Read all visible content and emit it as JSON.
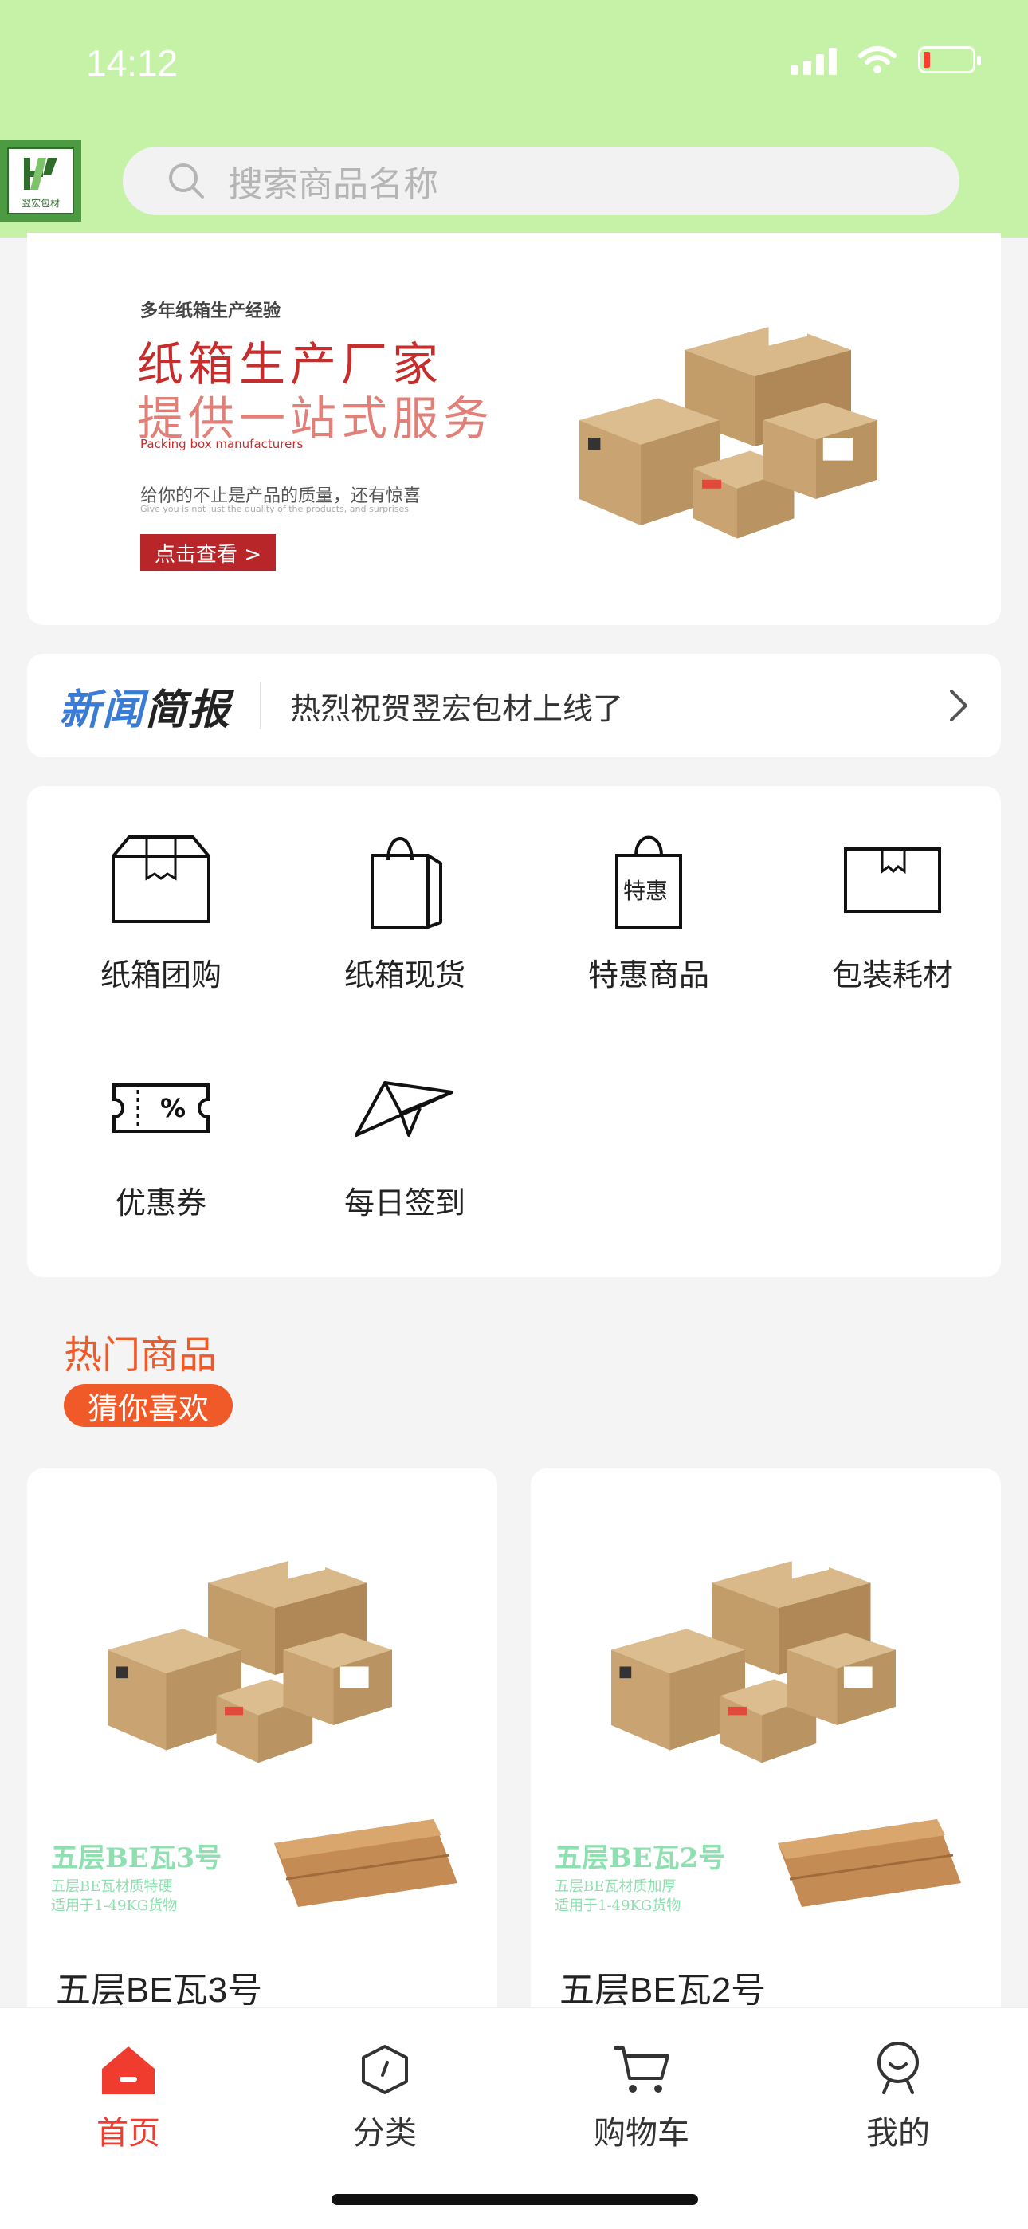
{
  "status": {
    "time": "14:12"
  },
  "header": {
    "logo_text": "翌宏包材",
    "search_placeholder": "搜索商品名称"
  },
  "banner": {
    "subtitle": "多年纸箱生产经验",
    "title_line1": "纸箱生产厂家",
    "title_line2": "提供一站式服务",
    "english": "Packing box manufacturers",
    "desc": "给你的不止是产品的质量，还有惊喜",
    "desc_en": "Give you is not just the quality of the products, and surprises",
    "button": "点击查看 >"
  },
  "news": {
    "label_a": "新闻",
    "label_b": "简报",
    "text": "热烈祝贺翌宏包材上线了"
  },
  "grid": {
    "items": [
      {
        "label": "纸箱团购",
        "icon": "box-icon"
      },
      {
        "label": "纸箱现货",
        "icon": "shopping-bag-icon"
      },
      {
        "label": "特惠商品",
        "icon": "special-bag-icon",
        "badge": "特惠"
      },
      {
        "label": "包装耗材",
        "icon": "package-icon"
      },
      {
        "label": "优惠券",
        "icon": "coupon-icon"
      },
      {
        "label": "每日签到",
        "icon": "paper-plane-icon"
      }
    ]
  },
  "hot": {
    "title": "热门商品",
    "tag": "猜你喜欢"
  },
  "products": [
    {
      "name": "五层BE瓦3号",
      "img_title": "五层BE瓦3号",
      "img_l1": "五层BE瓦材质特硬",
      "img_l2": "适用于1-49KG货物"
    },
    {
      "name": "五层BE瓦2号",
      "img_title": "五层BE瓦2号",
      "img_l1": "五层BE瓦材质加厚",
      "img_l2": "适用于1-49KG货物"
    }
  ],
  "tabs": [
    {
      "label": "首页",
      "icon": "home-icon",
      "active": true
    },
    {
      "label": "分类",
      "icon": "category-icon"
    },
    {
      "label": "购物车",
      "icon": "cart-icon"
    },
    {
      "label": "我的",
      "icon": "profile-icon"
    }
  ],
  "colors": {
    "accent": "#f05a28",
    "topbar": "#c6f2a8",
    "active_tab": "#f03c2e"
  }
}
